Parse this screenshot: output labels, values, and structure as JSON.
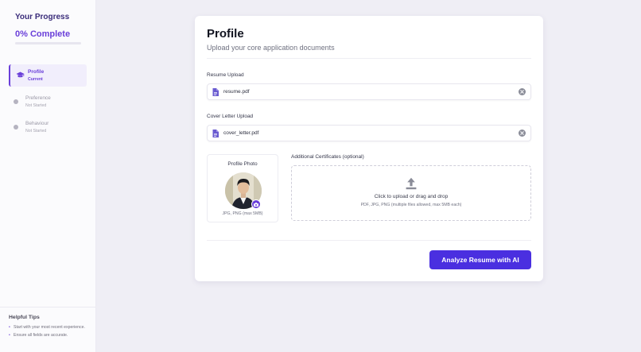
{
  "sidebar": {
    "title": "Your Progress",
    "progress_percent": 0,
    "progress_label": "0% Complete",
    "steps": [
      {
        "name": "Profile",
        "status": "Current",
        "icon": "graduation-cap-icon"
      },
      {
        "name": "Preference",
        "status": "Not Started"
      },
      {
        "name": "Behaviour",
        "status": "Not Started"
      }
    ],
    "tips": {
      "title": "Helpful Tips",
      "items": [
        "Start with your most recent experience.",
        "Ensure all fields are accurate."
      ]
    }
  },
  "main": {
    "title": "Profile",
    "subtitle": "Upload your core application documents",
    "resume": {
      "label": "Resume Upload",
      "file": "resume.pdf",
      "icon": "file-icon"
    },
    "cover_letter": {
      "label": "Cover Letter Upload",
      "file": "cover_letter.pdf",
      "icon": "file-icon"
    },
    "photo": {
      "label": "Profile Photo",
      "hint": "JPG, PNG (max 5MB)"
    },
    "certificates": {
      "label": "Additional Certificates (optional)",
      "main_text": "Click to upload or drag and drop",
      "sub_text": "PDF, JPG, PNG (multiple files allowed, max 5MB each)",
      "icon": "upload-icon"
    },
    "analyze_button": "Analyze Resume with AI"
  },
  "colors": {
    "accent": "#6a3fd9",
    "button": "#4a2fe0",
    "page_bg": "#efeef5"
  }
}
